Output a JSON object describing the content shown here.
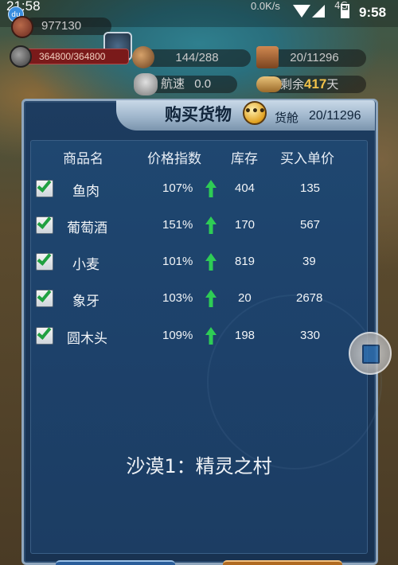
{
  "status_bar": {
    "time_left": "21:58",
    "net_speed": "0.0K/s",
    "network": "4G",
    "time_right": "9:58",
    "app_badge": "du"
  },
  "hud": {
    "gold": "977130",
    "durability": "364800/364800",
    "crew": "144/288",
    "cargo": "20/11296",
    "speed_label": "航速",
    "speed_value": "0.0",
    "days_prefix": "剩余",
    "days_value": "417",
    "days_suffix": "天"
  },
  "dialog": {
    "title": "购买货物",
    "cabin_label": "货舱",
    "cabin_value": "20/11296",
    "columns": [
      "商品名",
      "价格指数",
      "库存",
      "买入单价"
    ],
    "rows": [
      {
        "name": "鱼肉",
        "index": "107%",
        "stock": "404",
        "price": "135",
        "checked": true,
        "trend": "up"
      },
      {
        "name": "葡萄酒",
        "index": "151%",
        "stock": "170",
        "price": "567",
        "checked": true,
        "trend": "up"
      },
      {
        "name": "小麦",
        "index": "101%",
        "stock": "819",
        "price": "39",
        "checked": true,
        "trend": "up"
      },
      {
        "name": "象牙",
        "index": "103%",
        "stock": "20",
        "price": "2678",
        "checked": true,
        "trend": "up"
      },
      {
        "name": "圆木头",
        "index": "109%",
        "stock": "198",
        "price": "330",
        "checked": true,
        "trend": "up"
      }
    ],
    "location": "沙漠1：精灵之村"
  },
  "colors": {
    "panel_bg": "#1d416a",
    "accent_gold": "#f1c24a",
    "trend_up": "#2ecc55",
    "check": "#20a040"
  }
}
